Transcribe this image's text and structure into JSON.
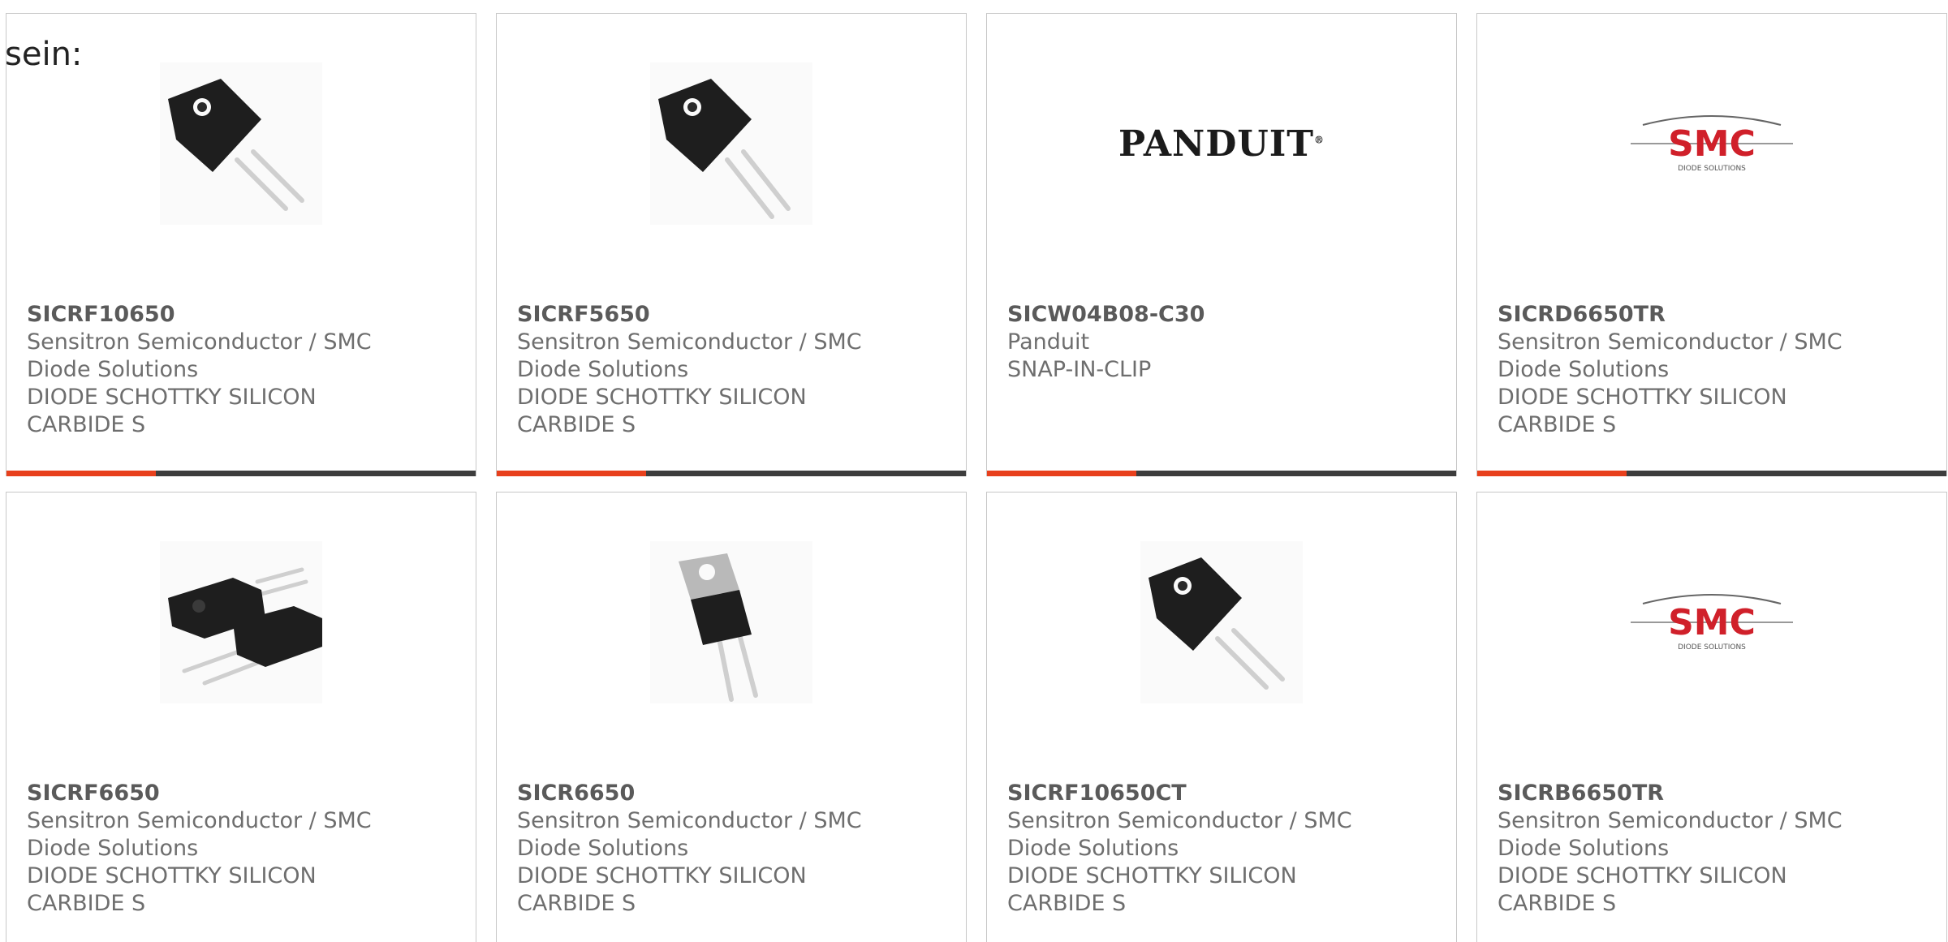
{
  "lead_text": "sein:",
  "colors": {
    "accent": "#e8401c",
    "bar": "#3d3d3d",
    "border": "#c8c8c8",
    "smc_red": "#d0202a"
  },
  "cards": [
    {
      "part": "SICRF10650",
      "manufacturer": "Sensitron Semiconductor / SMC\nDiode Solutions",
      "description": "DIODE SCHOTTKY SILICON\nCARBIDE S",
      "image": "to220f-transistor-icon"
    },
    {
      "part": "SICRF5650",
      "manufacturer": "Sensitron Semiconductor / SMC\nDiode Solutions",
      "description": "DIODE SCHOTTKY SILICON\nCARBIDE S",
      "image": "to220f-transistor-icon"
    },
    {
      "part": "SICW04B08-C30",
      "manufacturer": "Panduit",
      "description": "SNAP-IN-CLIP",
      "image": "panduit-logo",
      "logo_text": "PANDUIT"
    },
    {
      "part": "SICRD6650TR",
      "manufacturer": "Sensitron Semiconductor / SMC\nDiode Solutions",
      "description": "DIODE SCHOTTKY SILICON\nCARBIDE S",
      "image": "smc-logo",
      "logo_text": "SMC",
      "logo_subtext": "DIODE SOLUTIONS"
    },
    {
      "part": "SICRF6650",
      "manufacturer": "Sensitron Semiconductor / SMC\nDiode Solutions",
      "description": "DIODE SCHOTTKY SILICON\nCARBIDE S",
      "image": "dual-transistor-icon"
    },
    {
      "part": "SICR6650",
      "manufacturer": "Sensitron Semiconductor / SMC\nDiode Solutions",
      "description": "DIODE SCHOTTKY SILICON\nCARBIDE S",
      "image": "to220-transistor-icon"
    },
    {
      "part": "SICRF10650CT",
      "manufacturer": "Sensitron Semiconductor / SMC\nDiode Solutions",
      "description": "DIODE SCHOTTKY SILICON\nCARBIDE S",
      "image": "to220f-transistor-icon"
    },
    {
      "part": "SICRB6650TR",
      "manufacturer": "Sensitron Semiconductor / SMC\nDiode Solutions",
      "description": "DIODE SCHOTTKY SILICON\nCARBIDE S",
      "image": "smc-logo",
      "logo_text": "SMC",
      "logo_subtext": "DIODE SOLUTIONS"
    }
  ]
}
